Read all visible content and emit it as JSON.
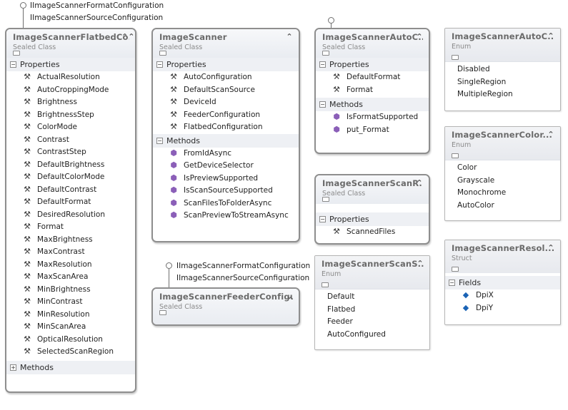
{
  "flatbed": {
    "interfaces": [
      "IImageScannerFormatConfiguration",
      "IImageScannerSourceConfiguration"
    ],
    "title": "ImageScannerFlatbedCo...",
    "stereotype": "Sealed Class",
    "properties_label": "Properties",
    "properties": [
      "ActualResolution",
      "AutoCroppingMode",
      "Brightness",
      "BrightnessStep",
      "ColorMode",
      "Contrast",
      "ContrastStep",
      "DefaultBrightness",
      "DefaultColorMode",
      "DefaultContrast",
      "DefaultFormat",
      "DesiredResolution",
      "Format",
      "MaxBrightness",
      "MaxContrast",
      "MaxResolution",
      "MaxScanArea",
      "MinBrightness",
      "MinContrast",
      "MinResolution",
      "MinScanArea",
      "OpticalResolution",
      "SelectedScanRegion"
    ],
    "methods_label": "Methods"
  },
  "scanner": {
    "title": "ImageScanner",
    "stereotype": "Sealed Class",
    "properties_label": "Properties",
    "properties": [
      "AutoConfiguration",
      "DefaultScanSource",
      "DeviceId",
      "FeederConfiguration",
      "FlatbedConfiguration"
    ],
    "methods_label": "Methods",
    "methods": [
      "FromIdAsync",
      "GetDeviceSelector",
      "IsPreviewSupported",
      "IsScanSourceSupported",
      "ScanFilesToFolderAsync",
      "ScanPreviewToStreamAsync"
    ]
  },
  "feeder": {
    "interfaces": [
      "IImageScannerFormatConfiguration",
      "IImageScannerSourceConfiguration"
    ],
    "title": "ImageScannerFeederConfigu...",
    "stereotype": "Sealed Class"
  },
  "auto_config": {
    "title": "ImageScannerAutoC...",
    "stereotype": "Sealed Class",
    "properties_label": "Properties",
    "properties": [
      "DefaultFormat",
      "Format"
    ],
    "methods_label": "Methods",
    "methods": [
      "IsFormatSupported",
      "put_Format"
    ]
  },
  "scan_result": {
    "title": "ImageScannerScanR...",
    "stereotype": "Sealed Class",
    "properties_label": "Properties",
    "properties": [
      "ScannedFiles"
    ]
  },
  "scan_source": {
    "title": "ImageScannerScanS...",
    "stereotype": "Enum",
    "values": [
      "Default",
      "Flatbed",
      "Feeder",
      "AutoConfigured"
    ]
  },
  "auto_crop": {
    "title": "ImageScannerAutoC...",
    "stereotype": "Enum",
    "values": [
      "Disabled",
      "SingleRegion",
      "MultipleRegion"
    ]
  },
  "color_mode": {
    "title": "ImageScannerColor...",
    "stereotype": "Enum",
    "values": [
      "Color",
      "Grayscale",
      "Monochrome",
      "AutoColor"
    ]
  },
  "resolution": {
    "title": "ImageScannerResol...",
    "stereotype": "Struct",
    "fields_label": "Fields",
    "fields": [
      "DpiX",
      "DpiY"
    ]
  },
  "icons": {
    "collapse": "chevron-up-icon",
    "expand": "chevron-down-icon",
    "property": "wrench-icon",
    "method": "method-cube-icon",
    "field": "field-cube-icon"
  }
}
